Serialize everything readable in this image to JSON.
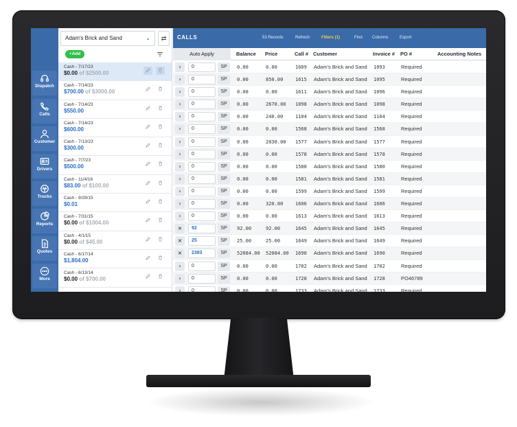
{
  "nav": [
    {
      "label": "Dispatch",
      "icon": "headset-icon"
    },
    {
      "label": "Calls",
      "icon": "phone-icon"
    },
    {
      "label": "Customer",
      "icon": "person-icon"
    },
    {
      "label": "Drivers",
      "icon": "id-card-icon"
    },
    {
      "label": "Trucks",
      "icon": "truck-icon"
    },
    {
      "label": "Reports",
      "icon": "pie-chart-icon"
    },
    {
      "label": "Quotes",
      "icon": "document-icon"
    },
    {
      "label": "More",
      "icon": "more-icon"
    }
  ],
  "list_panel": {
    "company": "Adam's Brick and Sand",
    "add_label": "+Add",
    "entries": [
      {
        "title": "Cash - 7/17/23",
        "amount": "$0.00",
        "of": "of $2500.00",
        "amount_style": "dark",
        "selected": true
      },
      {
        "title": "Cash - 7/14/23",
        "amount": "$700.00",
        "of": "of $3000.00",
        "amount_style": "blue"
      },
      {
        "title": "Cash - 7/14/23",
        "amount": "$550.00",
        "of": "",
        "amount_style": "blue"
      },
      {
        "title": "Cash - 7/14/23",
        "amount": "$600.00",
        "of": "",
        "amount_style": "blue"
      },
      {
        "title": "Cash - 7/13/23",
        "amount": "$300.00",
        "of": "",
        "amount_style": "blue"
      },
      {
        "title": "Cash - 7/7/23",
        "amount": "$500.00",
        "of": "",
        "amount_style": "blue"
      },
      {
        "title": "Cash - 11/4/16",
        "amount": "$83.00",
        "of": "of $100.00",
        "amount_style": "blue"
      },
      {
        "title": "Cash - 9/29/15",
        "amount": "$0.01",
        "of": "",
        "amount_style": "blue"
      },
      {
        "title": "Cash - 7/31/15",
        "amount": "$0.00",
        "of": "of $1004.00",
        "amount_style": "dark"
      },
      {
        "title": "Cash - 4/1/15",
        "amount": "$0.00",
        "of": "of $45.00",
        "amount_style": "dark"
      },
      {
        "title": "Cash - 6/17/14",
        "amount": "$1,804.00",
        "of": "",
        "amount_style": "blue"
      },
      {
        "title": "Cash - 6/13/14",
        "amount": "$0.00",
        "of": "of $700.00",
        "amount_style": "dark"
      }
    ]
  },
  "toolbar": {
    "title": "CALLS",
    "records": "53 Records",
    "refresh": "Refresh",
    "filters": "Filters (1)",
    "find": "Find",
    "columns": "Columns",
    "export": "Export"
  },
  "columns": {
    "auto_apply": "Auto Apply",
    "balance": "Balance",
    "price": "Price",
    "call": "Call #",
    "customer": "Customer",
    "invoice": "Invoice #",
    "po": "PO #",
    "notes": "Accounting Notes"
  },
  "rows": [
    {
      "exp": "›",
      "apply": "0",
      "sp": "SP",
      "balance": "0.00",
      "price": "0.00",
      "call": "1609",
      "customer": "Adam's Brick and Sand",
      "invoice": "1093",
      "po": "Required"
    },
    {
      "exp": "›",
      "apply": "0",
      "sp": "SP",
      "balance": "0.00",
      "price": "850.00",
      "call": "1615",
      "customer": "Adam's Brick and Sand",
      "invoice": "1095",
      "po": "Required"
    },
    {
      "exp": "›",
      "apply": "0",
      "sp": "SP",
      "balance": "0.00",
      "price": "0.00",
      "call": "1611",
      "customer": "Adam's Brick and Sand",
      "invoice": "1096",
      "po": "Required"
    },
    {
      "exp": "›",
      "apply": "0",
      "sp": "SP",
      "balance": "0.00",
      "price": "2670.00",
      "call": "1098",
      "customer": "Adam's Brick and Sand",
      "invoice": "1098",
      "po": "Required"
    },
    {
      "exp": "›",
      "apply": "0",
      "sp": "SP",
      "balance": "0.00",
      "price": "240.00",
      "call": "1104",
      "customer": "Adam's Brick and Sand",
      "invoice": "1104",
      "po": "Required"
    },
    {
      "exp": "›",
      "apply": "0",
      "sp": "SP",
      "balance": "0.00",
      "price": "0.00",
      "call": "1568",
      "customer": "Adam's Brick and Sand",
      "invoice": "1568",
      "po": "Required"
    },
    {
      "exp": "›",
      "apply": "0",
      "sp": "SP",
      "balance": "0.00",
      "price": "2030.00",
      "call": "1577",
      "customer": "Adam's Brick and Sand",
      "invoice": "1577",
      "po": "Required"
    },
    {
      "exp": "›",
      "apply": "0",
      "sp": "SP",
      "balance": "0.00",
      "price": "0.00",
      "call": "1578",
      "customer": "Adam's Brick and Sand",
      "invoice": "1578",
      "po": "Required"
    },
    {
      "exp": "›",
      "apply": "0",
      "sp": "SP",
      "balance": "0.00",
      "price": "0.00",
      "call": "1580",
      "customer": "Adam's Brick and Sand",
      "invoice": "1580",
      "po": "Required"
    },
    {
      "exp": "›",
      "apply": "0",
      "sp": "SP",
      "balance": "0.00",
      "price": "0.00",
      "call": "1581",
      "customer": "Adam's Brick and Sand",
      "invoice": "1581",
      "po": "Required"
    },
    {
      "exp": "›",
      "apply": "0",
      "sp": "SP",
      "balance": "0.00",
      "price": "0.00",
      "call": "1599",
      "customer": "Adam's Brick and Sand",
      "invoice": "1599",
      "po": "Required"
    },
    {
      "exp": "›",
      "apply": "0",
      "sp": "SP",
      "balance": "0.00",
      "price": "320.00",
      "call": "1606",
      "customer": "Adam's Brick and Sand",
      "invoice": "1606",
      "po": "Required"
    },
    {
      "exp": "›",
      "apply": "0",
      "sp": "SP",
      "balance": "0.00",
      "price": "0.00",
      "call": "1613",
      "customer": "Adam's Brick and Sand",
      "invoice": "1613",
      "po": "Required"
    },
    {
      "exp": "×",
      "apply": "92",
      "sp": "SP",
      "balance": "92.00",
      "price": "92.00",
      "call": "1645",
      "customer": "Adam's Brick and Sand",
      "invoice": "1645",
      "po": "Required",
      "filled": true
    },
    {
      "exp": "×",
      "apply": "25",
      "sp": "SP",
      "balance": "25.00",
      "price": "25.00",
      "call": "1649",
      "customer": "Adam's Brick and Sand",
      "invoice": "1649",
      "po": "Required",
      "filled": true
    },
    {
      "exp": "×",
      "apply": "2383",
      "sp": "SP",
      "balance": "52084.00",
      "price": "52084.00",
      "call": "1690",
      "customer": "Adam's Brick and Sand",
      "invoice": "1690",
      "po": "Required",
      "filled": true
    },
    {
      "exp": "›",
      "apply": "0",
      "sp": "SP",
      "balance": "0.00",
      "price": "0.00",
      "call": "1702",
      "customer": "Adam's Brick and Sand",
      "invoice": "1702",
      "po": "Required"
    },
    {
      "exp": "›",
      "apply": "0",
      "sp": "SP",
      "balance": "0.00",
      "price": "0.00",
      "call": "1728",
      "customer": "Adam's Brick and Sand",
      "invoice": "1728",
      "po": "PO46789"
    },
    {
      "exp": "›",
      "apply": "0",
      "sp": "SP",
      "balance": "0.00",
      "price": "0.00",
      "call": "1733",
      "customer": "Adam's Brick and Sand",
      "invoice": "1733",
      "po": "Required"
    }
  ]
}
